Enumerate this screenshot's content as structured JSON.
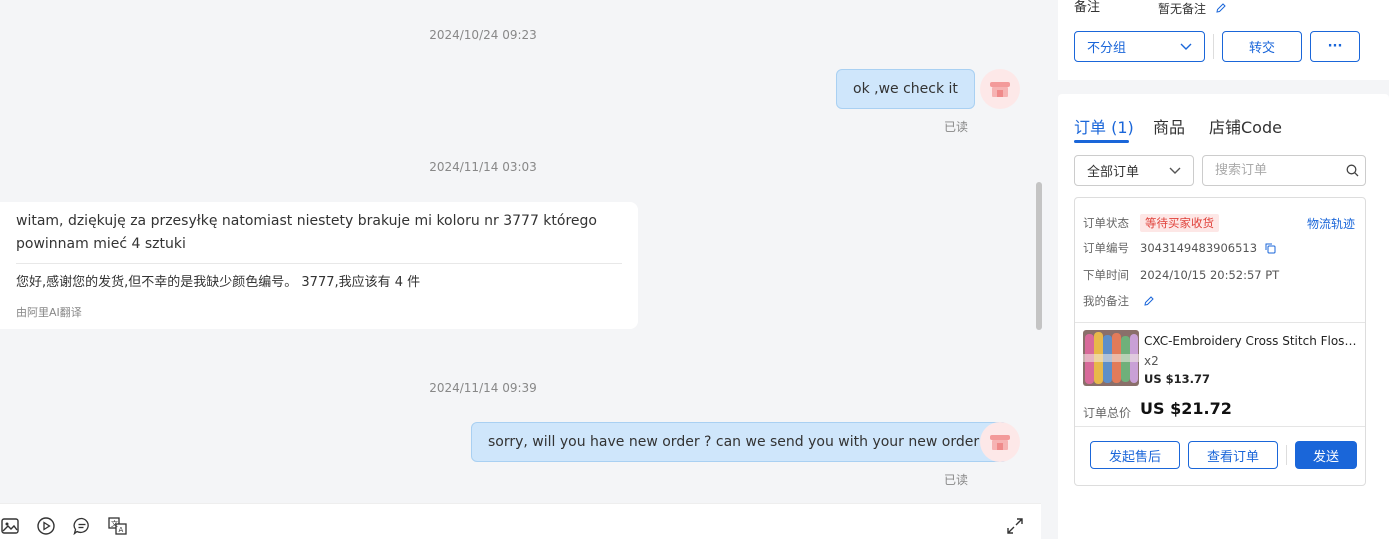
{
  "chat": {
    "messages": [
      {
        "timestamp": "2024/10/24 09:23",
        "text": "ok ,we check it",
        "status": "已读"
      },
      {
        "timestamp": "2024/11/14 03:03",
        "original": "witam, dziękuję za przesyłkę natomiast niestety brakuje mi koloru nr 3777 którego powinnam mieć 4 sztuki",
        "translation": "您好,感谢您的发货,但不幸的是我缺少颜色编号。 3777,我应该有 4 件",
        "translated_by": "由阿里AI翻译"
      },
      {
        "timestamp": "2024/11/14 09:39",
        "text": "sorry, will you have new order ? can we send you with your new order ?",
        "status": "已读"
      }
    ]
  },
  "toolbar": {
    "icons": [
      "image-icon",
      "video-icon",
      "quick-reply-icon",
      "translate-icon",
      "expand-icon"
    ]
  },
  "panel": {
    "note_label": "备注",
    "note_value": "暂无备注",
    "group_select": "不分组",
    "transfer_button": "转交",
    "more_button": "···",
    "tabs": [
      "订单 (1)",
      "商品",
      "店铺Code"
    ],
    "order_filter": "全部订单",
    "search_placeholder": "搜索订单",
    "order": {
      "status_label": "订单状态",
      "status_value": "等待买家收货",
      "logistics_link": "物流轨迹",
      "number_label": "订单编号",
      "number_value": "3043149483906513",
      "time_label": "下单时间",
      "time_value": "2024/10/15 20:52:57 PT",
      "remark_label": "我的备注",
      "product_title": "CXC-Embroidery Cross Stitch Floss T...",
      "product_qty": "x2",
      "product_price": "US $13.77",
      "total_label": "订单总价",
      "total_value": "US $21.72",
      "after_sale_button": "发起售后",
      "view_order_button": "查看订单",
      "send_button": "发送"
    }
  },
  "colors": {
    "accent": "#1a66d9",
    "bubble_out": "#cfe6fb",
    "status_badge_bg": "#fde7e6",
    "status_badge_text": "#e0413a"
  }
}
